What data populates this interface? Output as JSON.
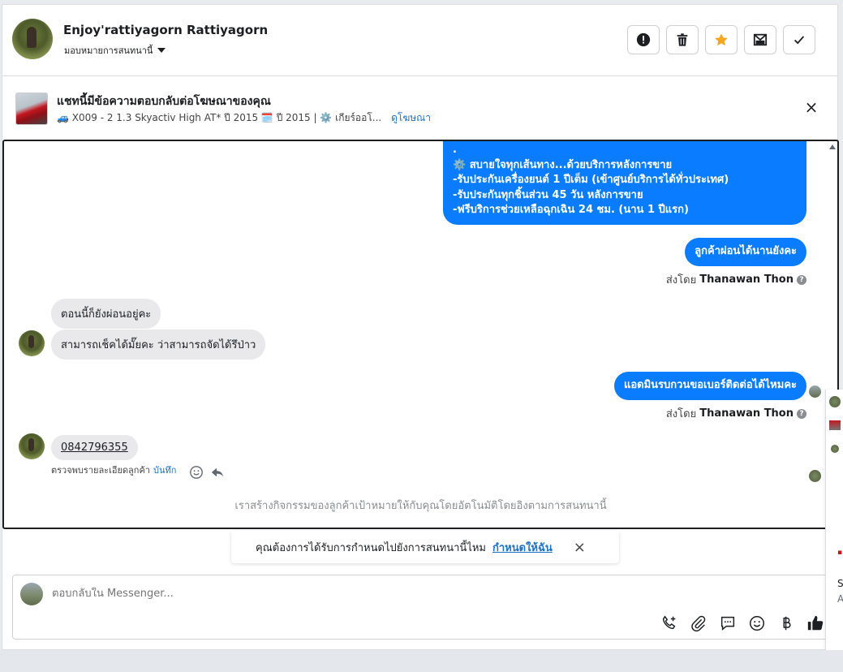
{
  "header": {
    "contact_name": "Enjoy'rattiyagorn Rattiyagorn",
    "assign_label": "มอบหมายการสนทนานี้",
    "buttons": [
      {
        "name": "spam-button",
        "icon": "exclamation-icon"
      },
      {
        "name": "delete-button",
        "icon": "trash-icon"
      },
      {
        "name": "star-button",
        "icon": "star-icon",
        "color": "#f5a623"
      },
      {
        "name": "mark-unread-button",
        "icon": "envelope-icon"
      },
      {
        "name": "done-button",
        "icon": "check-icon"
      }
    ]
  },
  "ad": {
    "title": "แชทนี้มีข้อความตอบกลับต่อโฆษณาของคุณ",
    "subtitle": "🚙 X009 - 2 1.3 Skyactiv High AT* ปี 2015 🗓️ ปี 2015 | ⚙️ เกียร์ออโ...",
    "link": "ดูโฆษณา",
    "close": "×"
  },
  "messages": {
    "first_out": {
      "line0": ".",
      "line1": "⚙️ สบายใจทุกเส้นทาง...ด้วยบริการหลังการขาย",
      "line2": "-รับประกันเครื่องยนต์ 1 ปีเต็ม (เข้าศูนย์บริการได้ทั่วประเทศ)",
      "line3": "-รับประกันทุกชิ้นส่วน 45 วัน หลังการขาย",
      "line4": "-ฟรีบริการช่วยเหลือฉุกเฉิน 24 ชม. (นาน 1 ปีแรก)"
    },
    "out2": "ลูกค้าผ่อนได้นานยังคะ",
    "sent_by_prefix": "ส่งโดย",
    "sent_by_name": "Thanawan Thon",
    "help_mark": "?",
    "in1": "ตอนนี้ก็ยังผ่อนอยู่คะ",
    "in2": "สามารถเช็คได้มั๊ยคะ ว่าสามารถจัดได้รึป่าว",
    "out3": "แอดมินรบกวนขอเบอร์ติดต่อได้ไหมคะ",
    "in3_phone": "0842796355",
    "note_label": "ตรวจพบรายละเอียดลูกค้า",
    "note_save": "บันทึก",
    "auto_text": "เราสร้างกิจกรรมของลูกค้าเป้าหมายให้กับคุณโดยอัตโนมัติโดยอิงตามการสนทนานี้"
  },
  "toast": {
    "text": "คุณต้องการได้รับการกำหนดไปยังการสนทนานี้ไหม",
    "link": "กำหนดให้ฉัน",
    "close": "×"
  },
  "composer": {
    "placeholder": "ตอบกลับใน Messenger...",
    "icons": [
      "call-add-icon",
      "attachment-icon",
      "saved-reply-icon",
      "emoji-icon",
      "baht-icon",
      "like-icon"
    ],
    "accent": "#1c1e21"
  },
  "side": {
    "letter_s": "S",
    "letter_a": "A"
  },
  "colors": {
    "outgoing_bubble": "#0a7cff",
    "incoming_bubble": "#e9e9eb",
    "link": "#1a73c8"
  }
}
